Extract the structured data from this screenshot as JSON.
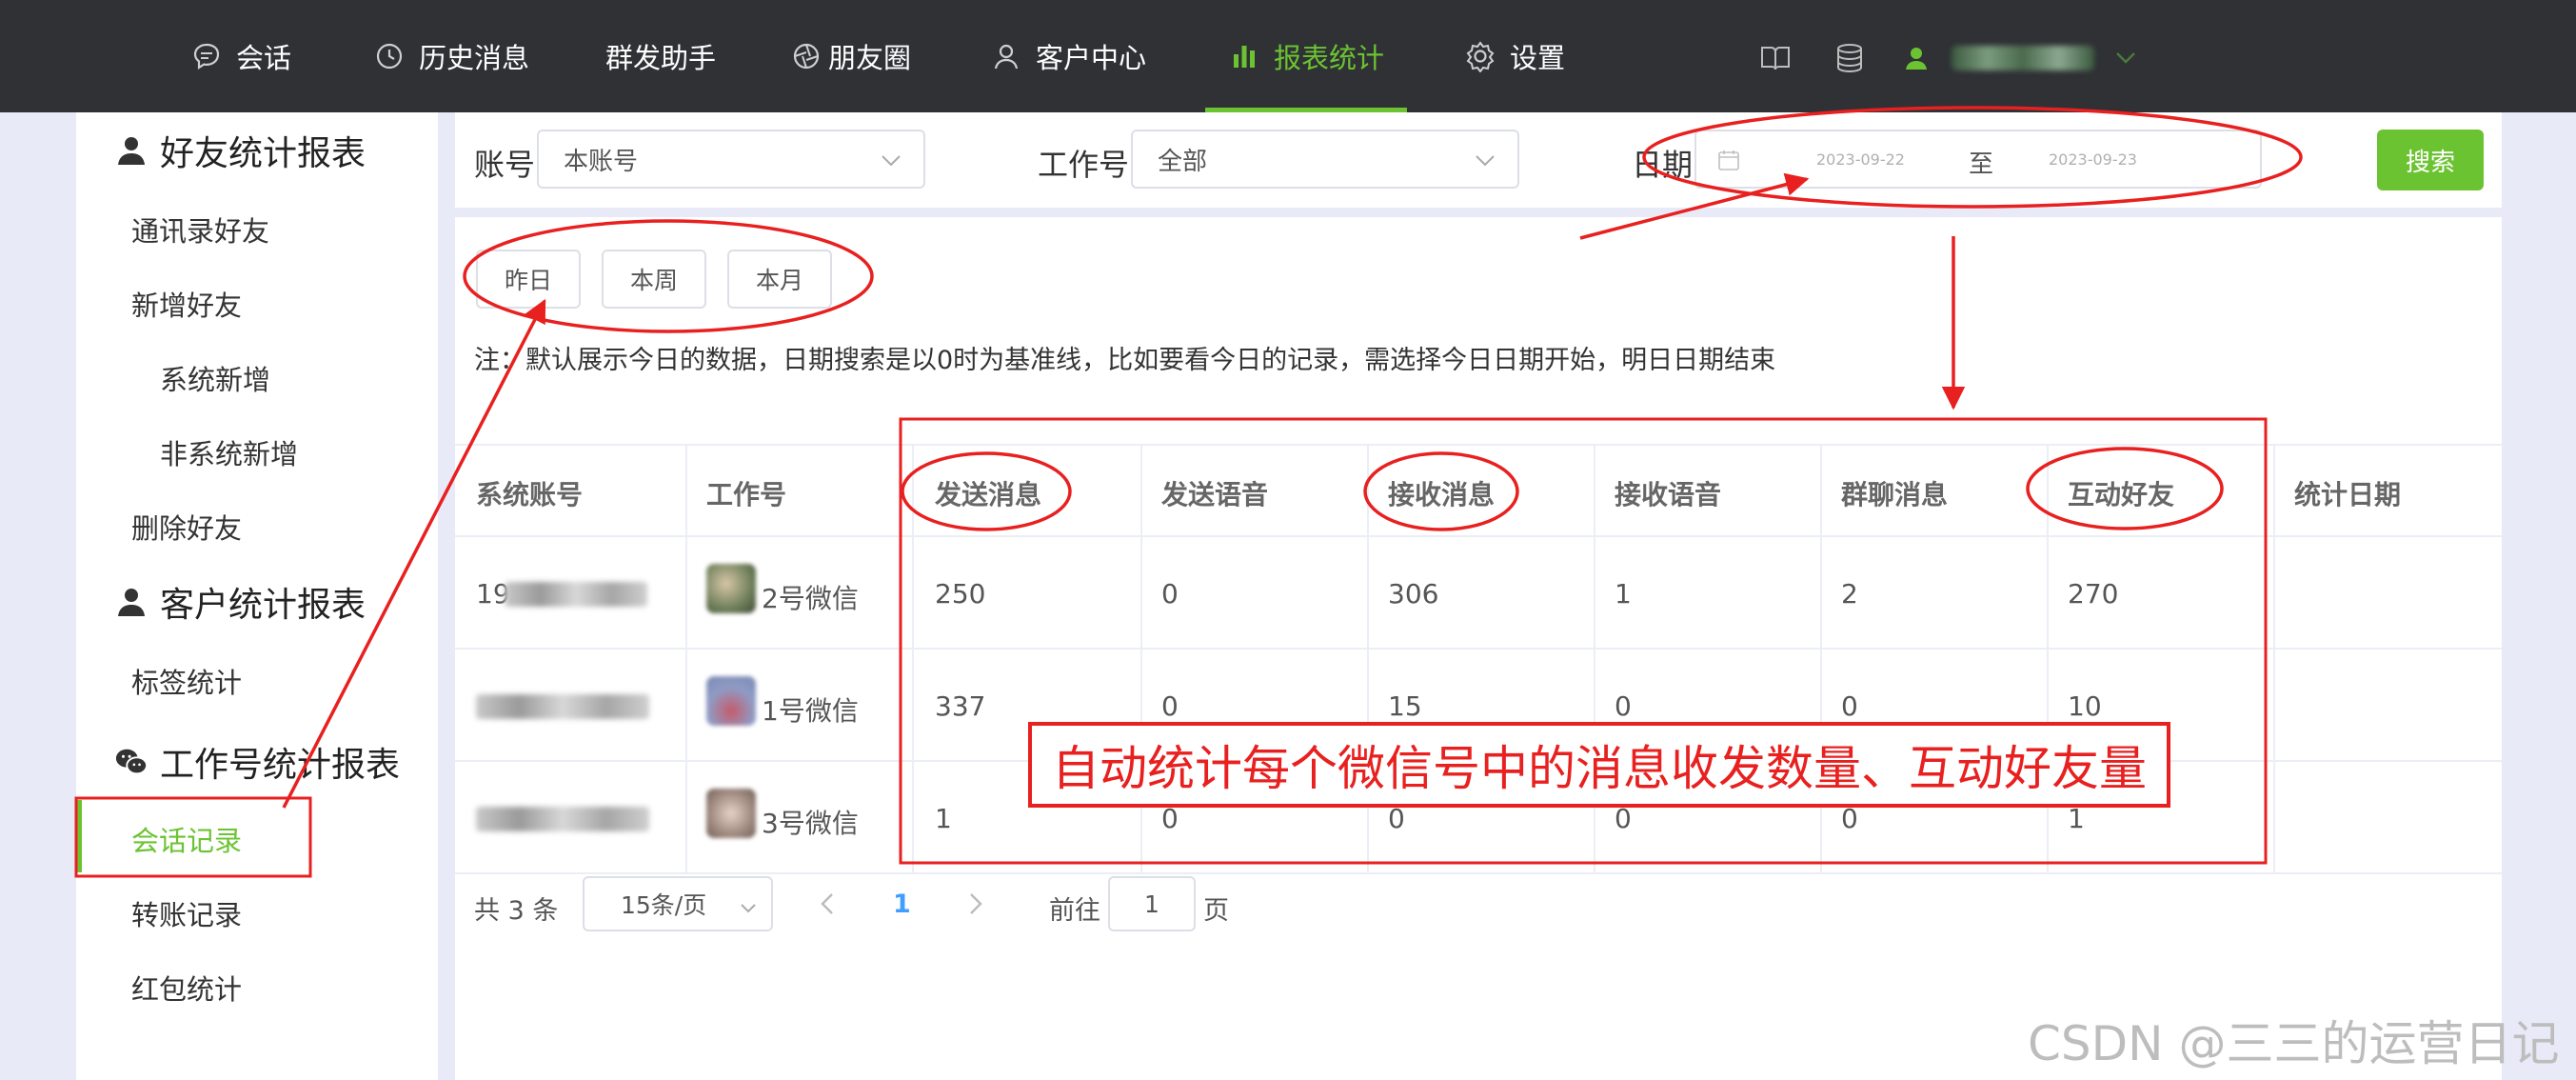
{
  "topnav": {
    "items": [
      {
        "label": "会话",
        "icon": "chat-icon"
      },
      {
        "label": "历史消息",
        "icon": "clock-icon"
      },
      {
        "label": "群发助手",
        "icon": ""
      },
      {
        "label": "朋友圈",
        "icon": "aperture-icon"
      },
      {
        "label": "客户中心",
        "icon": "user-outline-icon"
      },
      {
        "label": "报表统计",
        "icon": "bar-chart-icon"
      },
      {
        "label": "设置",
        "icon": "gear-icon"
      }
    ],
    "active": "报表统计",
    "tools": [
      "book-icon",
      "database-icon",
      "user-icon"
    ]
  },
  "sidebar": {
    "groups": [
      {
        "label": "好友统计报表",
        "icon": "person-icon"
      },
      {
        "label": "客户统计报表",
        "icon": "person-icon"
      },
      {
        "label": "工作号统计报表",
        "icon": "wechat-icon"
      }
    ],
    "items": [
      "通讯录好友",
      "新增好友",
      "系统新增",
      "非系统新增",
      "删除好友",
      "标签统计",
      "会话记录",
      "转账记录",
      "红包统计"
    ],
    "active": "会话记录"
  },
  "filter": {
    "account_label": "账号",
    "account_value": "本账号",
    "workno_label": "工作号",
    "workno_value": "全部",
    "date_label": "日期",
    "date_start": "2023-09-22",
    "date_sep": "至",
    "date_end": "2023-09-23",
    "search_button": "搜索"
  },
  "quick_buttons": [
    "昨日",
    "本周",
    "本月"
  ],
  "note": "注：默认展示今日的数据，日期搜索是以0时为基准线，比如要看今日的记录，需选择今日日期开始，明日日期结束",
  "table": {
    "headers": [
      "系统账号",
      "工作号",
      "发送消息",
      "发送语音",
      "接收消息",
      "接收语音",
      "群聊消息",
      "互动好友",
      "统计日期"
    ],
    "rows": [
      {
        "account_prefix": "19",
        "workno": "2号微信",
        "send_msg": "250",
        "send_voice": "0",
        "recv_msg": "306",
        "recv_voice": "1",
        "group_msg": "2",
        "friends": "270"
      },
      {
        "account_prefix": "",
        "workno": "1号微信",
        "send_msg": "337",
        "send_voice": "0",
        "recv_msg": "15",
        "recv_voice": "0",
        "group_msg": "0",
        "friends": "10"
      },
      {
        "account_prefix": "",
        "workno": "3号微信",
        "send_msg": "1",
        "send_voice": "0",
        "recv_msg": "0",
        "recv_voice": "0",
        "group_msg": "0",
        "friends": "1"
      }
    ]
  },
  "pagination": {
    "total": "共 3 条",
    "page_size": "15条/页",
    "current_page": "1",
    "goto_label": "前往",
    "goto_value": "1",
    "page_suffix": "页"
  },
  "annotation": {
    "callout": "自动统计每个微信号中的消息收发数量、互动好友量",
    "color": "#e8201f"
  },
  "watermark": "CSDN @三三的运营日记",
  "colors": {
    "accent": "#6cc332",
    "nav_bg": "#2f3135",
    "page_bg": "#e8eaf7"
  }
}
